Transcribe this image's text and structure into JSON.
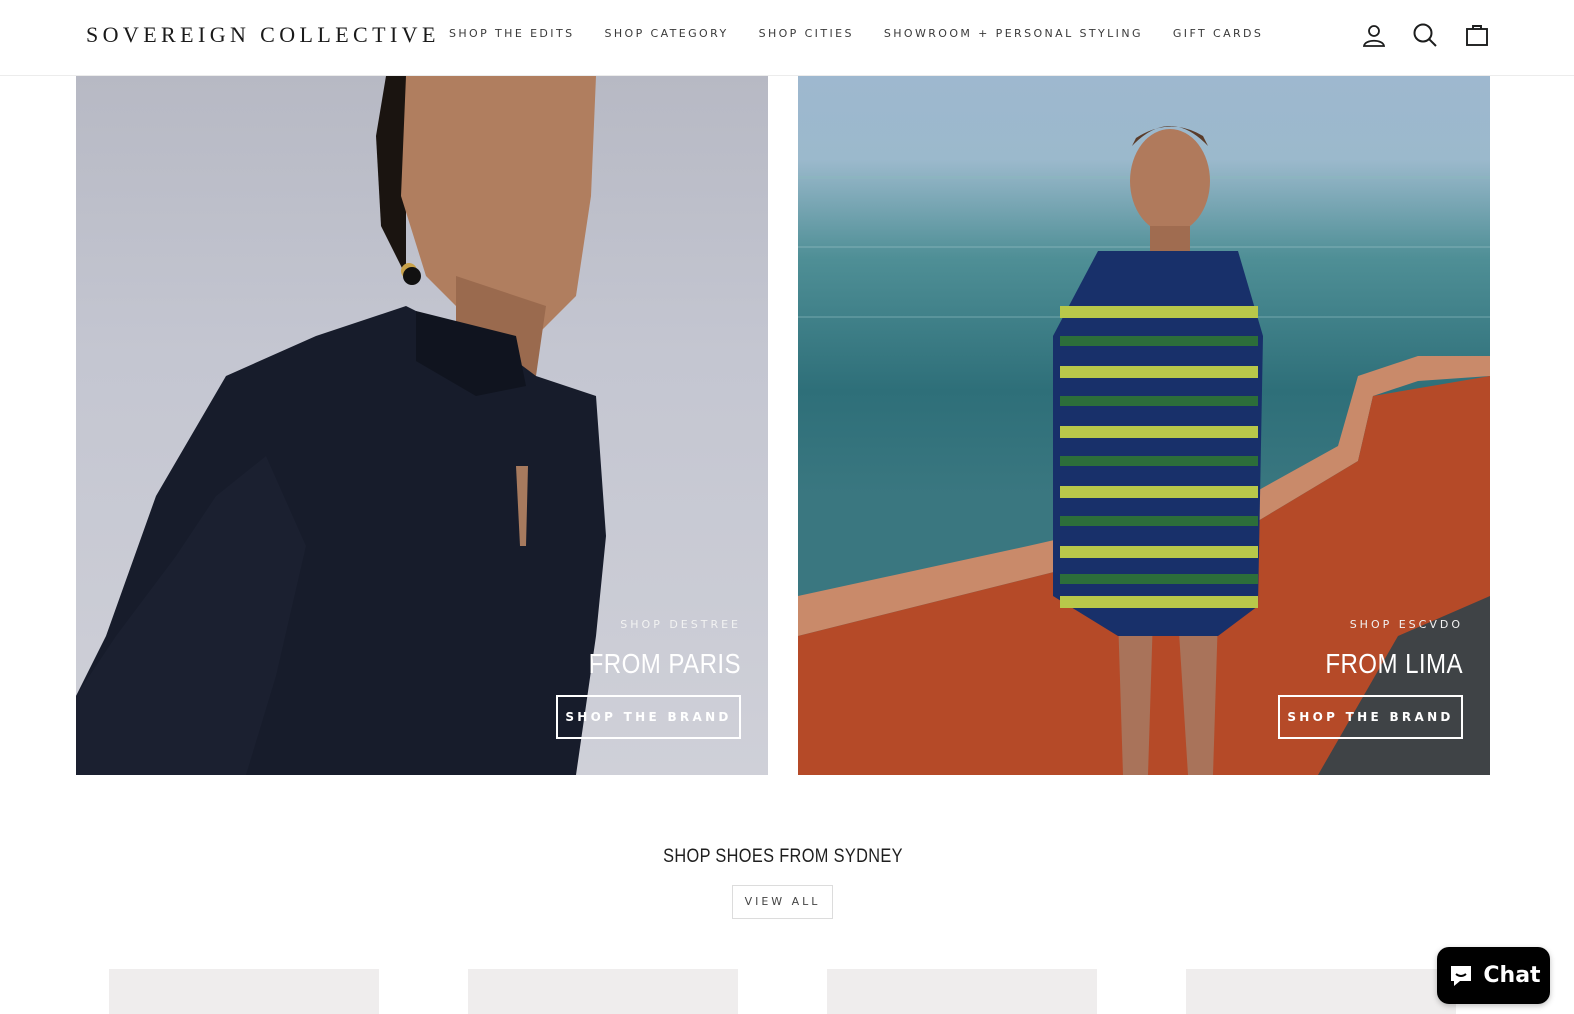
{
  "header": {
    "logo": "SOVEREIGN COLLECTIVE",
    "nav": [
      "SHOP THE EDITS",
      "SHOP CATEGORY",
      "SHOP CITIES",
      "SHOWROOM + PERSONAL STYLING",
      "GIFT CARDS"
    ],
    "icons": [
      "account-icon",
      "search-icon",
      "cart-icon"
    ]
  },
  "hero": {
    "left": {
      "kicker": "SHOP DESTREE",
      "city": "FROM PARIS",
      "cta": "SHOP THE BRAND"
    },
    "right": {
      "kicker": "SHOP ESCVDO",
      "city": "FROM LIMA",
      "cta": "SHOP THE BRAND"
    }
  },
  "section": {
    "title": "SHOP SHOES FROM SYDNEY",
    "view_all": "VIEW ALL"
  },
  "chat": {
    "label": "Chat"
  },
  "colors": {
    "text": "#1c1d1d",
    "chat_bg": "#000000",
    "tile_bg": "#efeded"
  }
}
